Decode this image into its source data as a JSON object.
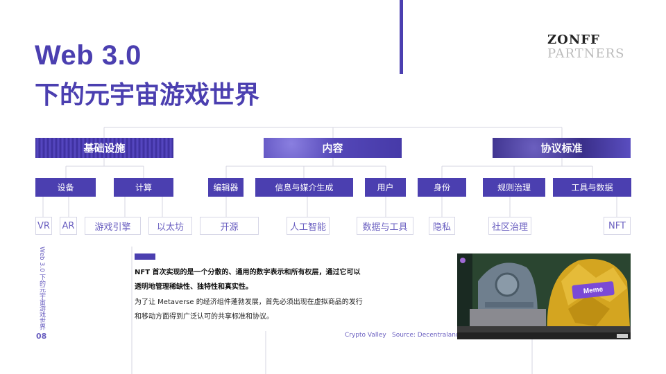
{
  "header": {
    "title_line1": "Web 3.0",
    "title_line2": "下的元宇宙游戏世界"
  },
  "logo": {
    "line1": "ZONFF",
    "line2": "PARTNERS"
  },
  "diagram": {
    "categories": [
      {
        "label": "基础设施"
      },
      {
        "label": "内容"
      },
      {
        "label": "协议标准"
      }
    ],
    "subcategories": [
      {
        "label": "设备"
      },
      {
        "label": "计算"
      },
      {
        "label": "编辑器"
      },
      {
        "label": "信息与媒介生成"
      },
      {
        "label": "用户"
      },
      {
        "label": "身份"
      },
      {
        "label": "规则治理"
      },
      {
        "label": "工具与数据"
      }
    ],
    "leaves": [
      {
        "label": "VR"
      },
      {
        "label": "AR"
      },
      {
        "label": "游戏引擎"
      },
      {
        "label": "以太坊"
      },
      {
        "label": "开源"
      },
      {
        "label": "人工智能"
      },
      {
        "label": "数据与工具"
      },
      {
        "label": "隐私"
      },
      {
        "label": "社区治理"
      },
      {
        "label": "NFT"
      }
    ]
  },
  "sidebar": {
    "vertical_text": "Web 3.0 下的元宇宙游戏世界",
    "page_number": "08"
  },
  "body": {
    "bold_text": "NFT 首次实现的是一个分散的、通用的数字表示和所有权层，通过它可以透明地管理稀缺性、独特性和真实性。",
    "normal_text": "为了让 Metaverse 的经济组件蓬勃发展，首先必须出现在虚拟商品的发行和移动方面得到广泛认可的共享标准和协议。"
  },
  "image": {
    "sign_text": "Meme",
    "caption_name": "Crypto Valley",
    "caption_source": "Source: Decentraland"
  },
  "colors": {
    "brand": "#4b3fb0",
    "accent_text": "#6a5fc0"
  }
}
